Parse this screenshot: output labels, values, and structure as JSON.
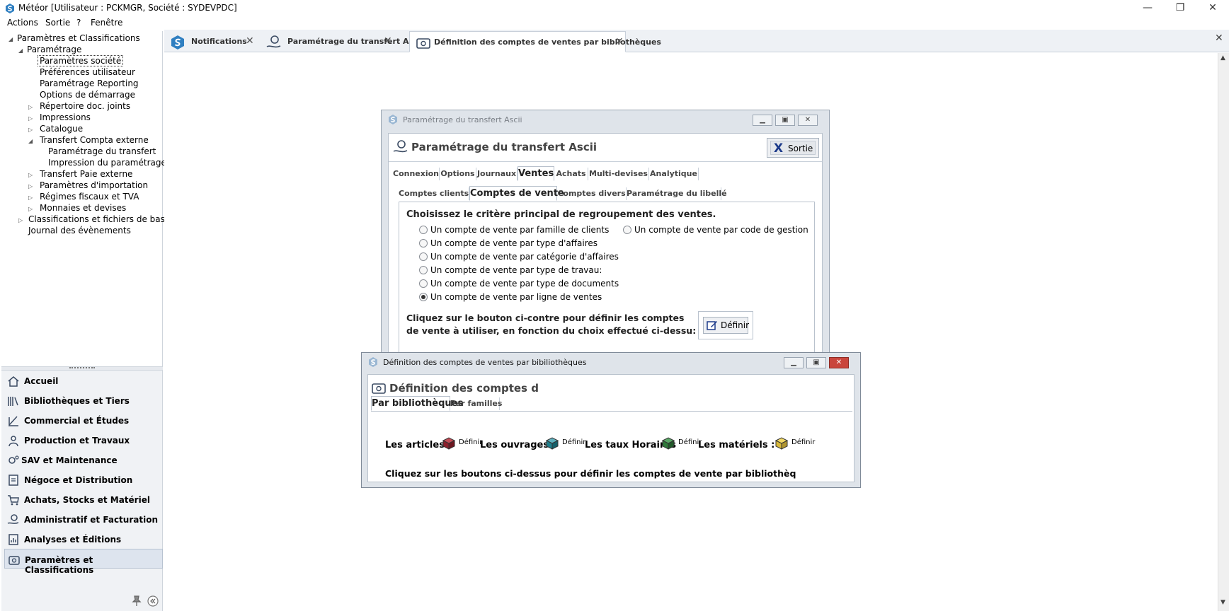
{
  "window": {
    "title": "Météor [Utilisateur : PCKMGR, Société : SYDEVPDC]",
    "minimize": "—",
    "restore": "❐",
    "close": "✕"
  },
  "menu": [
    "Actions",
    "Sortie",
    "?",
    "Fenêtre"
  ],
  "tree": {
    "root": "Paramètres et Classifications",
    "parametrage": "Paramétrage",
    "items": [
      "Paramètres société",
      "Préférences utilisateur",
      "Paramétrage Reporting",
      "Options de démarrage",
      "Répertoire doc. joints",
      "Impressions",
      "Catalogue",
      "Transfert Compta externe",
      "Paramétrage du transfert",
      "Impression du paramétrage",
      "Transfert Paie externe",
      "Paramètres d'importation",
      "Régimes fiscaux et TVA",
      "Monnaies et devises",
      "Classifications et fichiers de base",
      "Journal des évènements"
    ]
  },
  "nav": [
    "Accueil",
    "Bibliothèques et Tiers",
    "Commercial et Études",
    "Production et Travaux",
    "SAV et Maintenance",
    "Négoce et Distribution",
    "Achats, Stocks et Matériel",
    "Administratif et Facturation",
    "Analyses et Éditions",
    "Paramètres et Classifications"
  ],
  "tabs": [
    "Notifications",
    "Paramétrage du transfert Ascii",
    "Définition des comptes de ventes par bibliothèques"
  ],
  "tab_close": "✕",
  "win1": {
    "caption": "Paramétrage du transfert Ascii",
    "header": "Paramétrage du transfert Ascii",
    "exit": "Sortie",
    "tabs": [
      "Connexion",
      "Options",
      "Journaux",
      "Ventes",
      "Achats",
      "Multi-devises",
      "Analytique"
    ],
    "subtabs": [
      "Comptes clients",
      "Comptes de vente",
      "Comptes divers",
      "Paramétrage du libellé"
    ],
    "prompt": "Choisissez le critère principal de regroupement des ventes.",
    "options": [
      "Un compte de vente par famille de clients",
      "Un compte de vente par type d'affaires",
      "Un compte de vente par catégorie d'affaires",
      "Un compte de vente par type de travau:",
      "Un compte de vente par type de documents",
      "Un compte de vente par ligne de ventes"
    ],
    "option_right": "Un compte de vente par code de gestion",
    "help_line1": "Cliquez sur le bouton ci-contre pour définir les comptes",
    "help_line2": "de vente à utiliser, en fonction du choix effectué ci-dessu:",
    "define": "Définir"
  },
  "win2": {
    "caption": "Définition des comptes de ventes par bibiliothèques",
    "header": "Définition des comptes d",
    "tabs": [
      "Par bibliothèques",
      "Par familles"
    ],
    "articles": "Les articles :",
    "ouvrages": "Les ouvrages :",
    "taux": "Les taux Horaires",
    "materiels": "Les matériels :",
    "define": "Définir",
    "help": "Cliquez sur les boutons ci-dessus pour définir les comptes de vente par bibliothèq"
  },
  "colors": {
    "accent": "#2f7fc1",
    "book_red": "#8b1e2a",
    "book_teal": "#1f7f8c",
    "book_green": "#2f7a3a",
    "book_yellow": "#d8b93a"
  }
}
